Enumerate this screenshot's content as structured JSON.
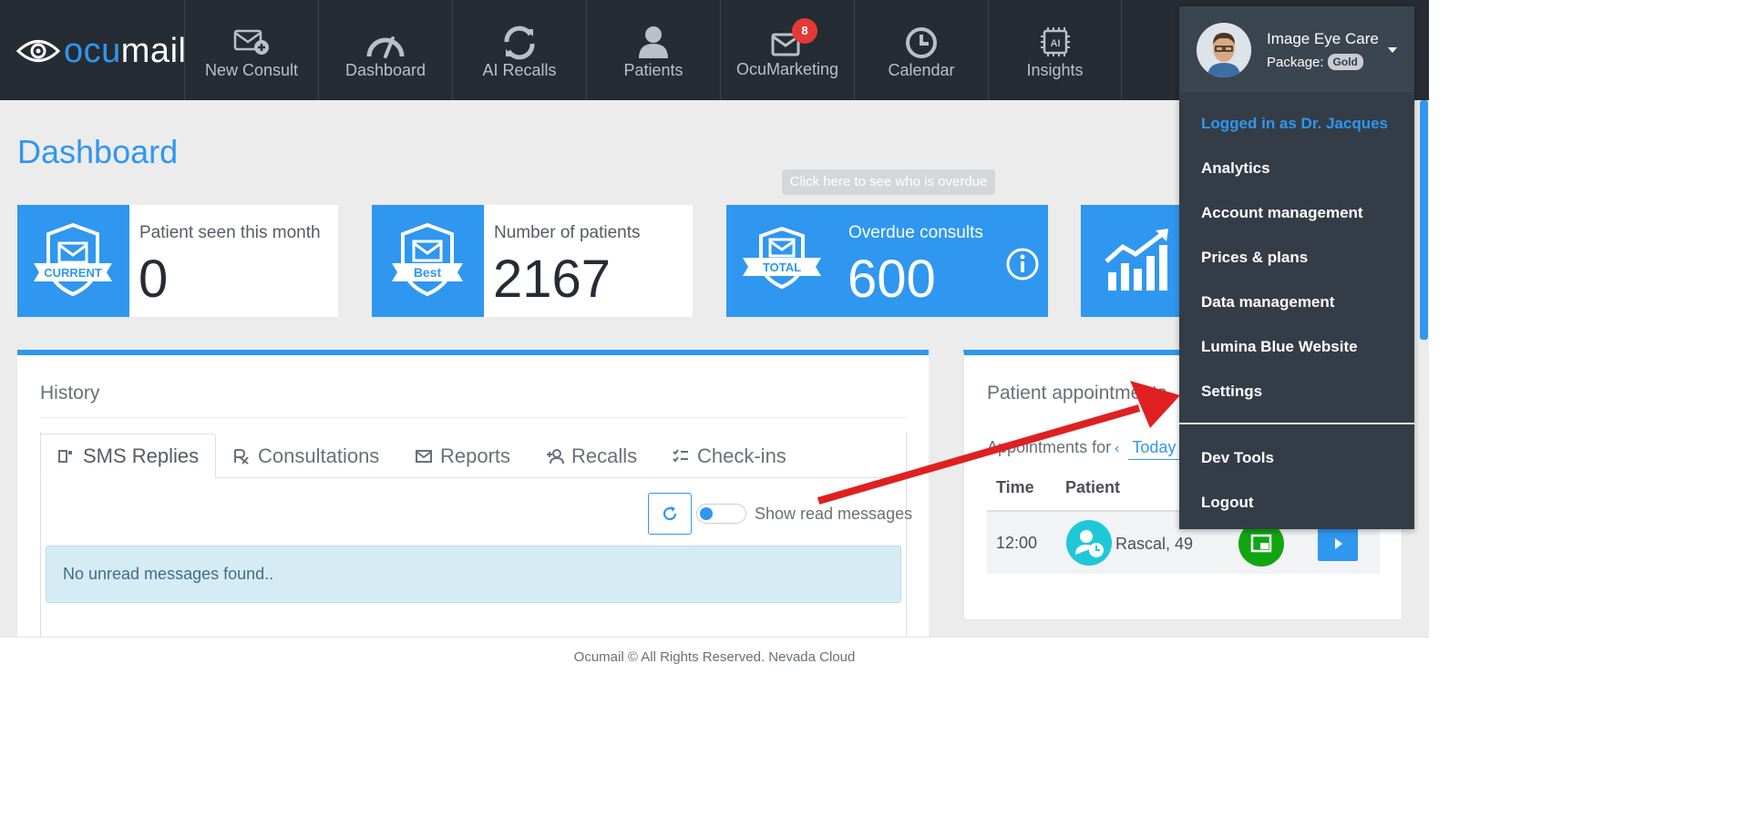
{
  "brand": {
    "logo_text_prefix": "ocu",
    "logo_text_suffix": "mail"
  },
  "nav": {
    "items": [
      {
        "label": "New Consult",
        "icon": "envelope-plus-icon"
      },
      {
        "label": "Dashboard",
        "icon": "gauge-icon"
      },
      {
        "label": "AI Recalls",
        "icon": "sync-icon"
      },
      {
        "label": "Patients",
        "icon": "user-icon"
      },
      {
        "label": "OcuMarketing",
        "icon": "mail-megaphone-icon",
        "badge": "8"
      },
      {
        "label": "Calendar",
        "icon": "clock-icon"
      },
      {
        "label": "Insights",
        "icon": "ai-chip-icon"
      }
    ]
  },
  "page": {
    "title": "Dashboard"
  },
  "stats": [
    {
      "label": "Patient seen this month",
      "value": "0",
      "icon_text": "CURRENT"
    },
    {
      "label": "Number of patients",
      "value": "2167",
      "icon_text": "Best"
    },
    {
      "label": "Overdue consults",
      "value": "600",
      "icon_text": "TOTAL"
    },
    {
      "label": "",
      "value": "",
      "icon": "growth-chart-icon"
    }
  ],
  "tooltip": {
    "text": "Click here to see who is overdue"
  },
  "history": {
    "title": "History",
    "tabs": [
      {
        "label": "SMS Replies",
        "icon": "sms-icon"
      },
      {
        "label": "Consultations",
        "icon": "rx-icon"
      },
      {
        "label": "Reports",
        "icon": "envelope-icon"
      },
      {
        "label": "Recalls",
        "icon": "user-plus-icon"
      },
      {
        "label": "Check-ins",
        "icon": "checklist-icon"
      }
    ],
    "toggle_label": "Show read messages",
    "empty_message": "No unread messages found.."
  },
  "appointments": {
    "title": "Patient appointments",
    "filter_label": "Appointments for",
    "date_label": "Today",
    "columns": [
      "Time",
      "Patient"
    ],
    "rows": [
      {
        "time": "12:00",
        "patient": "Rascal, 49"
      }
    ]
  },
  "footer": {
    "text": "Ocumail © All Rights Reserved. Nevada Cloud"
  },
  "user_menu": {
    "name": "Image Eye Care",
    "package_label": "Package:",
    "package_value": "Gold",
    "logged_in": "Logged in as Dr. Jacques",
    "items": [
      "Analytics",
      "Account management",
      "Prices & plans",
      "Data management",
      "Lumina Blue Website",
      "Settings"
    ],
    "bottom_items": [
      "Dev Tools",
      "Logout"
    ]
  },
  "colors": {
    "accent": "#2f97f0",
    "nav_bg": "#252c34",
    "menu_bg": "#343d47",
    "badge": "#e53935",
    "annotation_arrow": "#e02020"
  }
}
